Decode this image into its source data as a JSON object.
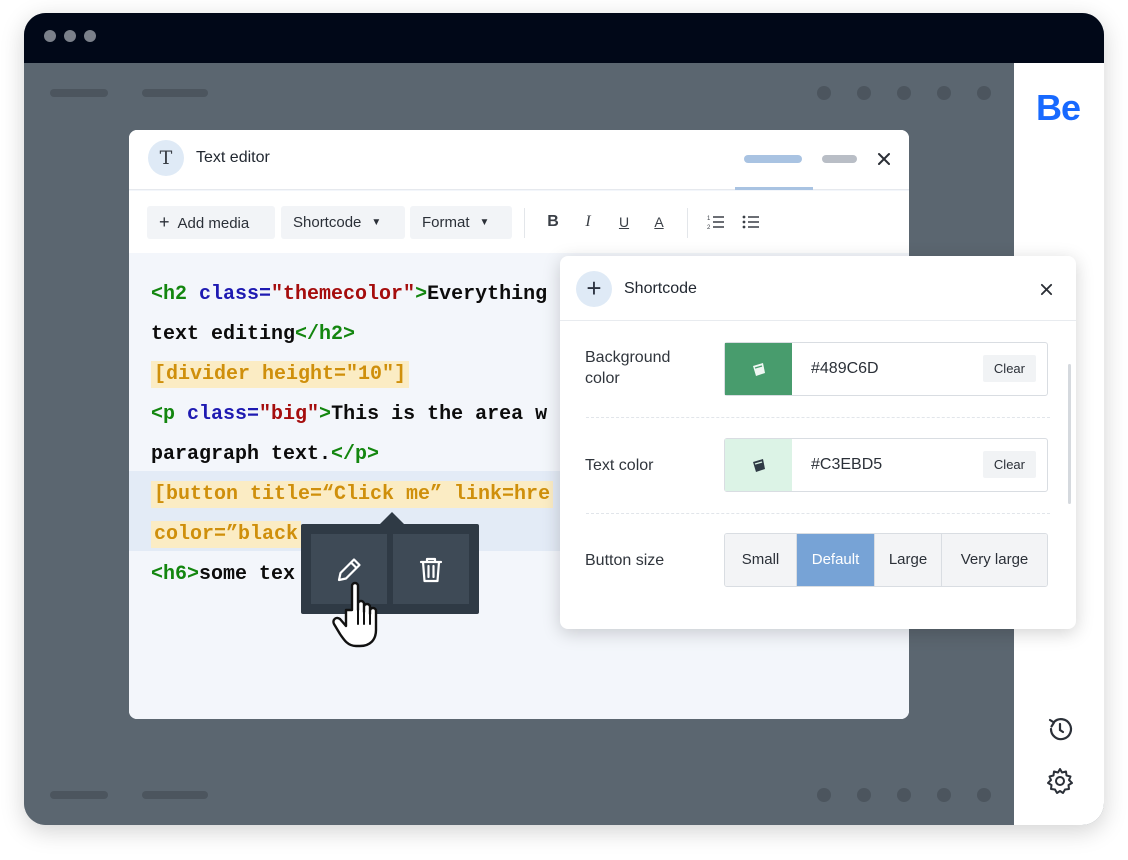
{
  "app": {
    "brand_logo": "Be",
    "brand_color": "#1769ff"
  },
  "editor": {
    "title": "Text editor",
    "badge_letter": "T",
    "toolbar": {
      "add_media": "Add media",
      "shortcode": "Shortcode",
      "format": "Format",
      "bold": "B",
      "italic": "I",
      "underline": "U",
      "text_color": "A"
    },
    "code": {
      "l1_open": "<h2 ",
      "l1_attr": "class=",
      "l1_val": "\"themecolor\"",
      "l1_close": ">",
      "l1_text": "Everything",
      "l2_text": "text editing",
      "l2_close": "</h2>",
      "l3": "[divider height=\"10\"]",
      "l4_open": "<p ",
      "l4_attr": "class=",
      "l4_val": "\"big\"",
      "l4_close": ">",
      "l4_text": "This is the area w",
      "l5_text": "paragraph text.",
      "l5_close": "</p>",
      "l6": "[button title=“Click me” link=hre",
      "l7": "color=”black",
      "l8_open": "<h6>",
      "l8_text": "some tex"
    }
  },
  "shortcode_panel": {
    "title": "Shortcode",
    "background_color": {
      "label": "Background color",
      "value": "#489C6D",
      "clear": "Clear"
    },
    "text_color": {
      "label": "Text color",
      "value": "#C3EBD5",
      "clear": "Clear"
    },
    "button_size": {
      "label": "Button size",
      "options": [
        "Small",
        "Default",
        "Large",
        "Very large"
      ],
      "selected": "Default"
    }
  },
  "colors": {
    "accent": "#77a3d6",
    "bg_swatch": "#489C6D",
    "text_swatch": "#C3EBD5",
    "tag_green": "#13860f",
    "attr_blue": "#1e1ab2",
    "string_red": "#a50d0d",
    "shortcode_amber": "#cf8f0b"
  },
  "icons": [
    "t-icon",
    "plus-icon",
    "caret-down-icon",
    "bold-icon",
    "italic-icon",
    "underline-icon",
    "text-color-icon",
    "ordered-list-icon",
    "bullet-list-icon",
    "close-icon",
    "paint-bucket-icon",
    "pencil-icon",
    "trash-icon",
    "hand-cursor-icon",
    "history-icon",
    "gear-icon"
  ]
}
